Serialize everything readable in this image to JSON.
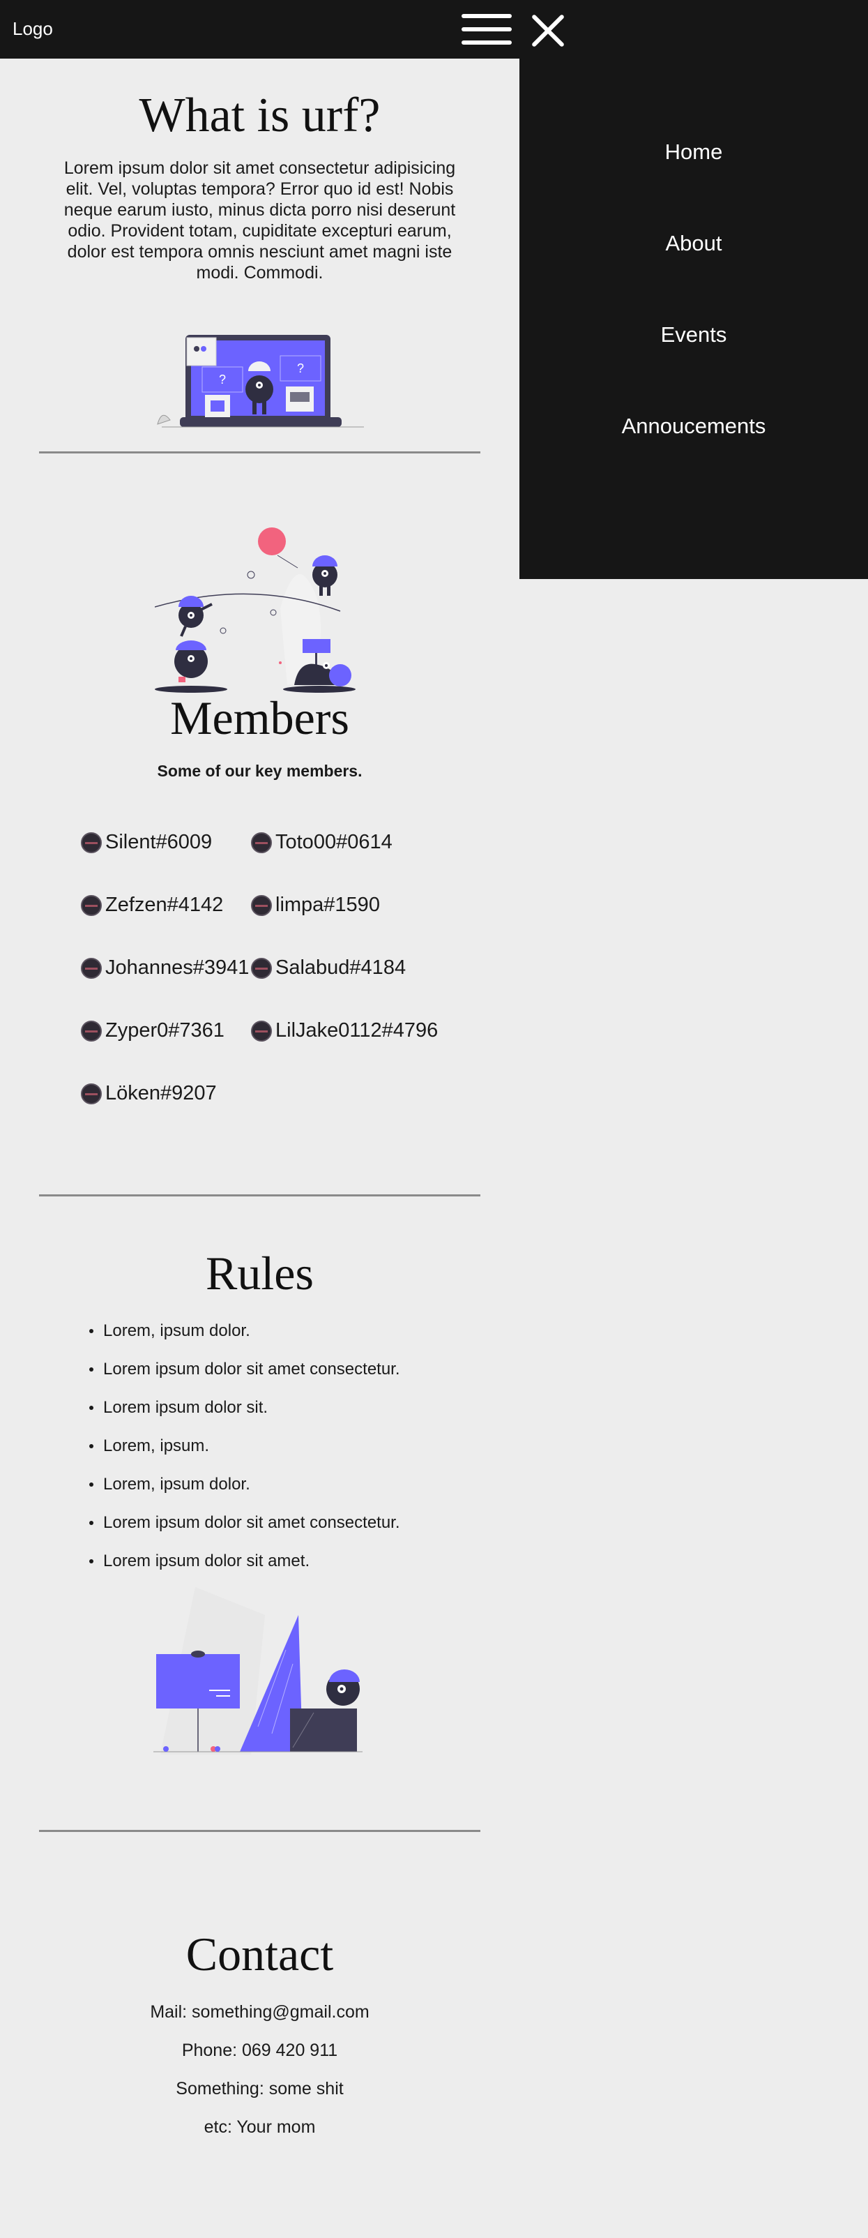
{
  "header": {
    "logo": "Logo"
  },
  "menu": {
    "items": [
      {
        "label": "Home"
      },
      {
        "label": "About"
      },
      {
        "label": "Events"
      },
      {
        "label": "Annoucements"
      }
    ]
  },
  "about": {
    "title": "What is urf?",
    "text": "Lorem ipsum dolor sit amet consectetur adipisicing elit. Vel, voluptas tempora? Error quo id est! Nobis neque earum iusto, minus dicta porro nisi deserunt odio. Provident totam, cupiditate excepturi earum, dolor est tempora omnis nesciunt amet magni iste modi. Commodi."
  },
  "members": {
    "title": "Members",
    "subtitle": "Some of our key members.",
    "list": [
      "Silent#6009",
      "Toto00#0614",
      "Zefzen#4142",
      "limpa#1590",
      "Johannes#3941",
      "Salabud#4184",
      "Zyper0#7361",
      "LilJake0112#4796",
      "Löken#9207"
    ]
  },
  "rules": {
    "title": "Rules",
    "items": [
      "Lorem, ipsum dolor.",
      "Lorem ipsum dolor sit amet consectetur.",
      "Lorem ipsum dolor sit.",
      "Lorem, ipsum.",
      "Lorem, ipsum dolor.",
      "Lorem ipsum dolor sit amet consectetur.",
      "Lorem ipsum dolor sit amet."
    ]
  },
  "contact": {
    "title": "Contact",
    "mail": "Mail: something@gmail.com",
    "phone": "Phone: 069 420 911",
    "something": "Something: some shit",
    "etc": "etc: Your mom"
  },
  "colors": {
    "accent": "#6c63ff",
    "dark": "#161616",
    "background": "#ededed",
    "balloon": "#f2637e"
  },
  "icons": {
    "menu": "hamburger-icon",
    "close": "close-icon",
    "avatar": "discord-avatar-icon"
  }
}
